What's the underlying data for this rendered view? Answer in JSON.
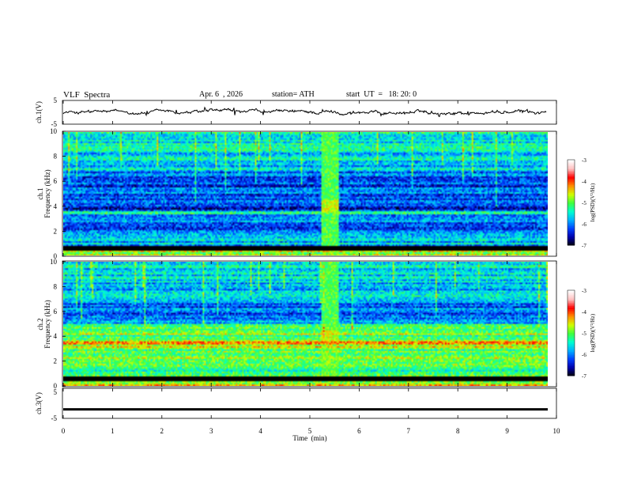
{
  "header": {
    "title": "VLF  Spectra",
    "date": "Apr. 6  , 2026",
    "station": "station= ATH",
    "start": "start  UT  =   18: 20: 0"
  },
  "chart_data": [
    {
      "type": "line",
      "panel": "ch1-voltage",
      "ylabel": "ch.1(V)",
      "ylim": [
        -5,
        5
      ],
      "yticks": [
        "5",
        "-5"
      ],
      "x_range_min": [
        0,
        9.8
      ],
      "series": [
        {
          "values_note_mean": 0,
          "approx_amplitude": 1.4
        }
      ]
    },
    {
      "type": "heatmap",
      "panel": "ch1-spectrogram",
      "ylabel": "ch.1\nFrequency (kHz)",
      "ylim": [
        0,
        10
      ],
      "yticks": [
        "10",
        "8",
        "6",
        "4",
        "2",
        "0"
      ],
      "xlim_min": [
        0,
        10
      ],
      "colorbar": {
        "label": "log(PSD)(V²/Hz)",
        "range": [
          -7,
          -3
        ],
        "ticks": [
          "-3",
          "-4",
          "-5",
          "-6",
          "-7"
        ]
      },
      "features": {
        "broadband_burst_min": [
          5.2,
          5.55
        ],
        "lower_band_hot_khz": [
          0,
          0.6
        ]
      }
    },
    {
      "type": "heatmap",
      "panel": "ch2-spectrogram",
      "ylabel": "ch.2\nFrequency (kHz)",
      "ylim": [
        0,
        10
      ],
      "yticks": [
        "10",
        "8",
        "6",
        "4",
        "2",
        "0"
      ],
      "xlim_min": [
        0,
        10
      ],
      "colorbar": {
        "label": "log(PSD)(V²/Hz)",
        "range": [
          -7,
          -3
        ],
        "ticks": [
          "-3",
          "-4",
          "-5",
          "-6",
          "-7"
        ]
      },
      "features": {
        "broadband_burst_min": [
          5.2,
          5.55
        ],
        "strong_band_khz": [
          3.3,
          3.7
        ]
      }
    },
    {
      "type": "line",
      "panel": "ch3-voltage",
      "ylabel": "ch.3(V)",
      "ylim": [
        -5,
        5
      ],
      "yticks": [
        "5",
        "-5"
      ],
      "series": [
        {
          "constant_value": -2
        }
      ]
    }
  ],
  "xaxis": {
    "label": "Time  (min)",
    "ticks": [
      "0",
      "1",
      "2",
      "3",
      "4",
      "5",
      "6",
      "7",
      "8",
      "9",
      "10"
    ]
  },
  "colors": {
    "colormap": [
      "#000000",
      "#0000aa",
      "#0040ff",
      "#00b0ff",
      "#00ffd0",
      "#40ff40",
      "#d0ff00",
      "#ff9000",
      "#ff0000",
      "#ffc0c0",
      "#ffffff"
    ]
  }
}
